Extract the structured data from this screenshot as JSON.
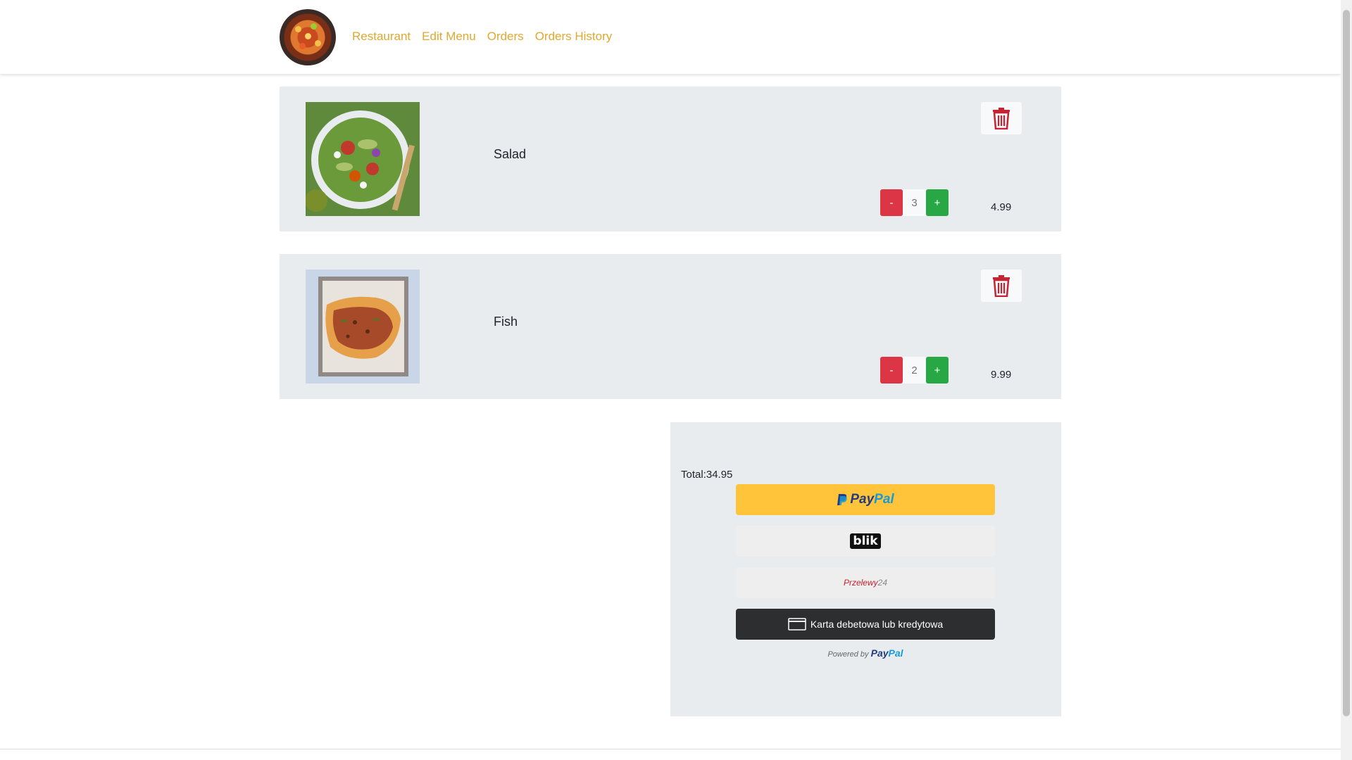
{
  "nav": {
    "links": [
      "Restaurant",
      "Edit Menu",
      "Orders",
      "Orders History"
    ]
  },
  "cart": {
    "items": [
      {
        "name": "Salad",
        "quantity": "3",
        "price": "4.99",
        "minus": "-",
        "plus": "+"
      },
      {
        "name": "Fish",
        "quantity": "2",
        "price": "9.99",
        "minus": "-",
        "plus": "+"
      }
    ]
  },
  "checkout": {
    "total_label": "Total:",
    "total_value": "34.95",
    "paypal_label_dark": "Pay",
    "paypal_label_light": "Pal",
    "blik_label": "blik",
    "p24_label": "Przelewy",
    "p24_num": "24",
    "card_label": "Karta debetowa lub kredytowa",
    "powered_by": "Powered by",
    "powered_brand_dark": "Pay",
    "powered_brand_light": "Pal"
  },
  "colors": {
    "nav_link": "#e0a82e",
    "minus": "#dc3545",
    "plus": "#28a745",
    "paypal_yellow": "#ffc439",
    "card_dark": "#2c2e2f"
  }
}
